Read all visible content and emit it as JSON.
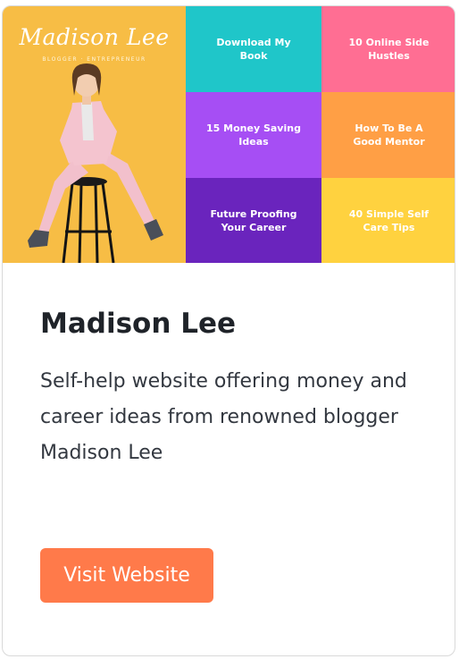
{
  "hero": {
    "logo_text": "Madison Lee",
    "tagline": "BLOGGER · ENTREPRENEUR",
    "tiles": [
      {
        "label": "Download My Book",
        "color": "#1fc6c9"
      },
      {
        "label": "10 Online Side Hustles",
        "color": "#ff6e93"
      },
      {
        "label": "15 Money Saving Ideas",
        "color": "#a64ef4"
      },
      {
        "label": "How To Be A Good Mentor",
        "color": "#ff9f45"
      },
      {
        "label": "Future Proofing Your Career",
        "color": "#6a24bd"
      },
      {
        "label": "40 Simple Self Care Tips",
        "color": "#ffd23f"
      }
    ]
  },
  "card": {
    "title": "Madison Lee",
    "description": "Self-help website offering money and career ideas from renowned blogger Madison Lee",
    "button_label": "Visit Website",
    "accent_color": "#ff7a4a"
  }
}
